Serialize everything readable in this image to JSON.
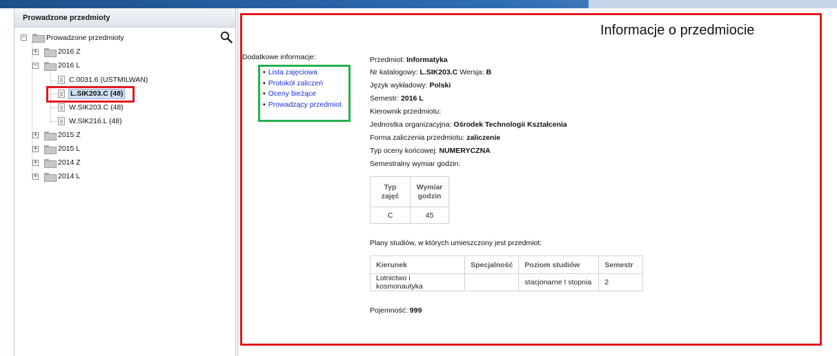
{
  "left_panel": {
    "title": "Prowadzone przedmioty",
    "root_label": "Prowadzone przedmioty",
    "tree": [
      {
        "label": "2016 Z",
        "expander": "+"
      },
      {
        "label": "2016 L",
        "expander": "−"
      },
      {
        "label": "C.0031.6 (USTMILWAN)"
      },
      {
        "label": "L.SIK203.C (48)"
      },
      {
        "label": "W.SIK203.C (48)"
      },
      {
        "label": "W.SIK216.L (48)"
      },
      {
        "label": "2015 Z",
        "expander": "+"
      },
      {
        "label": "2015 L",
        "expander": "+"
      },
      {
        "label": "2014 Z",
        "expander": "+"
      },
      {
        "label": "2014 L",
        "expander": "+"
      }
    ],
    "root_expander": "−"
  },
  "right_panel": {
    "title": "Informacje o przedmiocie",
    "additional_label": "Dodatkowe informacje:",
    "links": [
      "Lista zajęciowa",
      "Protokół zaliczeń",
      "Oceny bieżące",
      "Prowadzący przedmiot"
    ],
    "info": {
      "przedmiot_label": "Przedmiot: ",
      "przedmiot_value": "Informatyka",
      "nr_label": "Nr katalogowy: ",
      "nr_value": "L.SIK203.C",
      "wersja_label": " Wersja: ",
      "wersja_value": "B",
      "jezyk_label": "Język wykładowy: ",
      "jezyk_value": "Polski",
      "semestr_label": "Semestr: ",
      "semestr_value": "2016 L",
      "kierownik_label": "Kierownik przedmiotu:",
      "jednostka_label": "Jednostka organizacyjna: ",
      "jednostka_value": "Ośrodek Technologii Kształcenia",
      "forma_label": "Forma zaliczenia przedmiotu: ",
      "forma_value": "zaliczenie",
      "typ_label": "Typ oceny końcowej: ",
      "typ_value": "NUMERYCZNA",
      "wymiar_label": "Semestralny wymiar godzin:"
    },
    "hours_table": {
      "headers": [
        "Typ zajęć",
        "Wymiar",
        "godzin"
      ],
      "row": [
        "C",
        "45"
      ]
    },
    "plans_label": "Plany studiów, w których umieszczony jest przedmiot:",
    "plans_table": {
      "headers": [
        "Kierunek",
        "Specjalność",
        "Poziom studiów",
        "Semestr"
      ],
      "row": [
        "Lotnictwo i kosmonautyka",
        "",
        "stacjonarne I stopnia",
        "2"
      ]
    },
    "pojemnosc_label": "Pojemność: ",
    "pojemnosc_value": "999"
  }
}
